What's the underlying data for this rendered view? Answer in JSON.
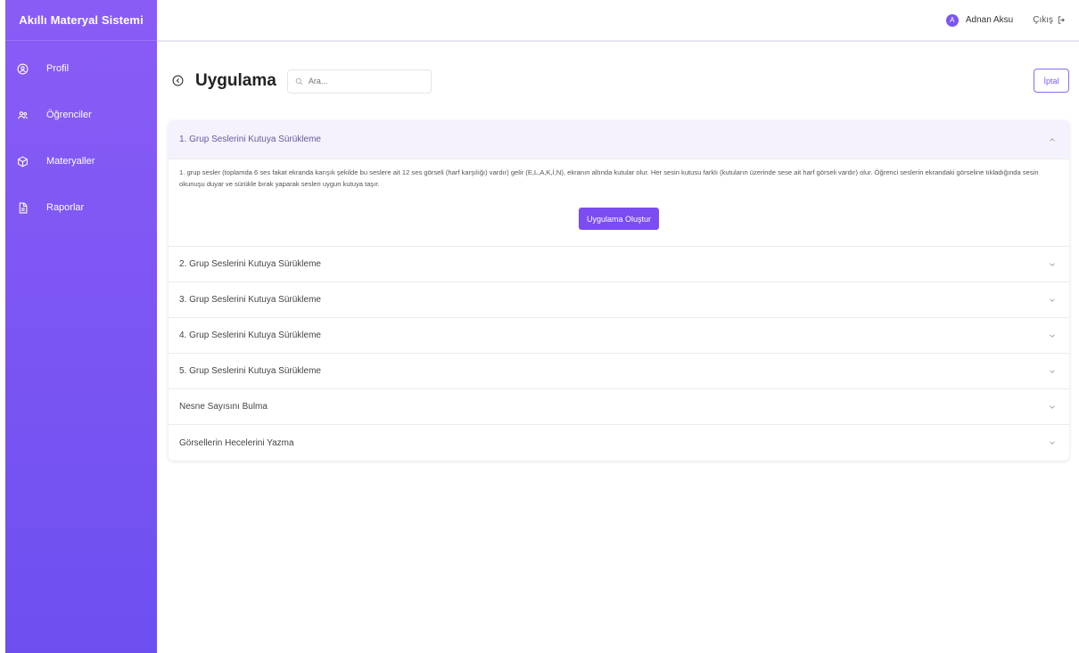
{
  "sidebar": {
    "brand": "Akıllı Materyal Sistemi",
    "items": [
      {
        "label": "Profil",
        "icon": "user-circle-icon"
      },
      {
        "label": "Öğrenciler",
        "icon": "users-icon"
      },
      {
        "label": "Materyaller",
        "icon": "cube-icon"
      },
      {
        "label": "Raporlar",
        "icon": "document-icon"
      }
    ]
  },
  "topbar": {
    "user_initial": "A",
    "user_name": "Adnan Aksu",
    "logout_label": "Çıkış"
  },
  "header": {
    "title": "Uygulama",
    "search_placeholder": "Ara...",
    "cancel_label": "İptal"
  },
  "accordion": {
    "open_item": {
      "title": "1. Grup Seslerini Kutuya Sürükleme",
      "description": "1. grup sesler (toplamda 6 ses fakat ekranda karışık şekilde bu seslere ait 12 ses görseli (harf karşılığı) vardır) gelir (E,L,A,K,İ,N), ekranın altında kutular olur. Her sesin kutusu farklı (kutuların üzerinde sese ait harf görseli vardır) olur. Öğrenci seslerin ekrandaki görseline tıkladığında sesin okunuşu duyar ve sürükle bırak yaparak sesleri uygun kutuya taşır.",
      "button": "Uygulama Oluştur"
    },
    "items": [
      "2. Grup Seslerini Kutuya Sürükleme",
      "3. Grup Seslerini Kutuya Sürükleme",
      "4. Grup Seslerini Kutuya Sürükleme",
      "5. Grup Seslerini Kutuya Sürükleme",
      "Nesne Sayısını Bulma",
      "Görsellerin Hecelerini Yazma"
    ]
  }
}
